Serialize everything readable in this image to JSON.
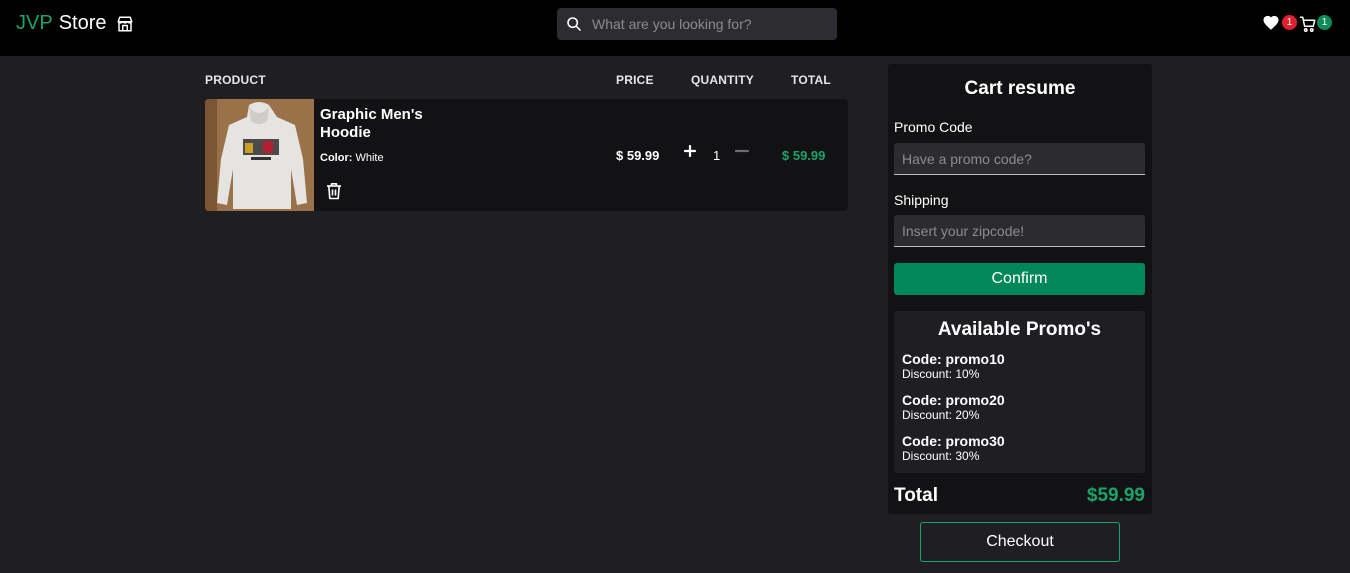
{
  "header": {
    "brand_accent": "JVP",
    "brand_name": "Store",
    "brand_icon": "storefront-icon",
    "search_placeholder": "What are you looking for?",
    "wishlist_count": "1",
    "cart_count": "1"
  },
  "table": {
    "columns": {
      "product": "PRODUCT",
      "price": "PRICE",
      "quantity": "QUANTITY",
      "total": "TOTAL"
    },
    "items": [
      {
        "name": "Graphic Men's Hoodie",
        "color_label": "Color:",
        "color_value": "White",
        "price": "$ 59.99",
        "quantity": "1",
        "total": "$ 59.99"
      }
    ]
  },
  "cart": {
    "title": "Cart resume",
    "promo_label": "Promo Code",
    "promo_placeholder": "Have a promo code?",
    "shipping_label": "Shipping",
    "shipping_placeholder": "Insert your zipcode!",
    "confirm_label": "Confirm",
    "promos_title": "Available Promo's",
    "promos": [
      {
        "code": "Code: promo10",
        "discount": "Discount: 10%"
      },
      {
        "code": "Code: promo20",
        "discount": "Discount: 20%"
      },
      {
        "code": "Code: promo30",
        "discount": "Discount: 30%"
      }
    ],
    "total_label": "Total",
    "total_value": "$59.99",
    "checkout_label": "Checkout"
  },
  "colors": {
    "accent": "#1aa36b",
    "confirm_bg": "#00875a",
    "wishlist_badge": "#e0202f",
    "cart_badge": "#0f8a5a",
    "page_bg": "#1f1e23"
  }
}
